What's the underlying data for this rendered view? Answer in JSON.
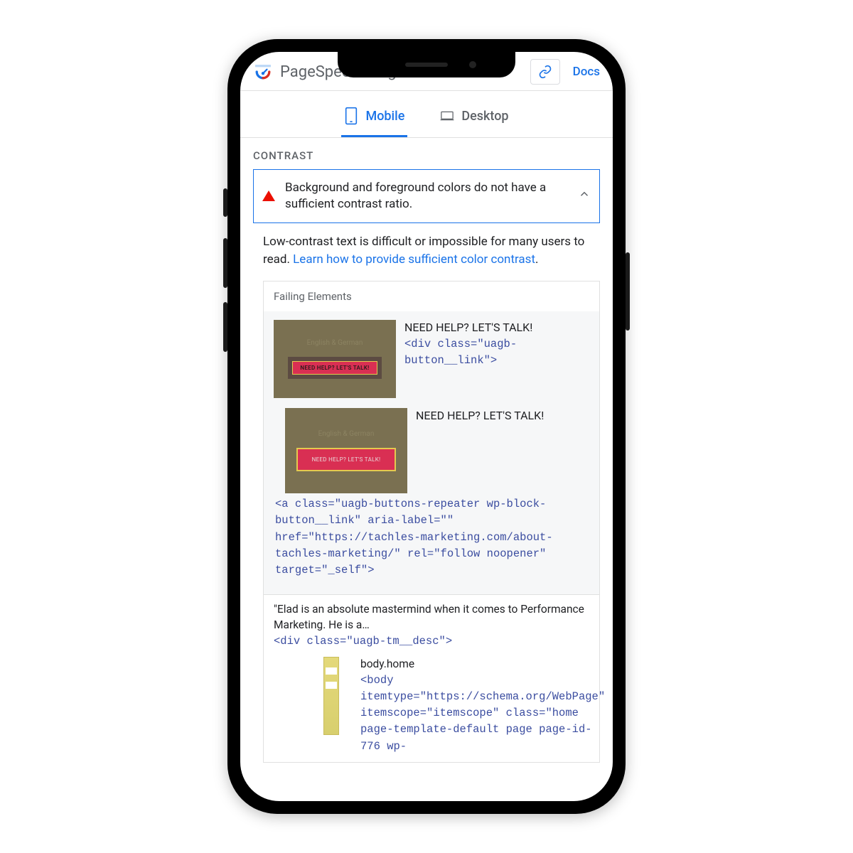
{
  "header": {
    "title": "PageSpeed Insights",
    "docs": "Docs"
  },
  "tabs": {
    "mobile": "Mobile",
    "desktop": "Desktop"
  },
  "section": {
    "label": "CONTRAST",
    "audit_title": "Background and foreground colors do not have a sufficient contrast ratio.",
    "desc_prefix": "Low-contrast text is difficult or impossible for many users to read. ",
    "desc_link": "Learn how to provide sufficient color contrast"
  },
  "panel": {
    "header": "Failing Elements",
    "items": [
      {
        "thumb_label": "English & German",
        "thumb_button": "NEED HELP? LET'S TALK!",
        "text": "NEED HELP? LET'S TALK!",
        "code": "<div class=\"uagb-button__link\">"
      },
      {
        "thumb_label": "English & German",
        "thumb_button": "NEED HELP? LET'S TALK!",
        "text": "NEED HELP? LET'S TALK!",
        "code": "<a class=\"uagb-buttons-repeater wp-block-button__link\" aria-label=\"\" href=\"https://tachles-marketing.com/about-tachles-marketing/\" rel=\"follow noopener\" target=\"_self\">"
      }
    ],
    "block3": {
      "text": "\"Elad is an absolute mastermind when it comes to Performance Marketing. He is a…",
      "code": "<div class=\"uagb-tm__desc\">"
    },
    "block4": {
      "text": "body.home",
      "code": "<body itemtype=\"https://schema.org/WebPage\" itemscope=\"itemscope\" class=\"home page-template-default page page-id-776 wp-"
    }
  }
}
